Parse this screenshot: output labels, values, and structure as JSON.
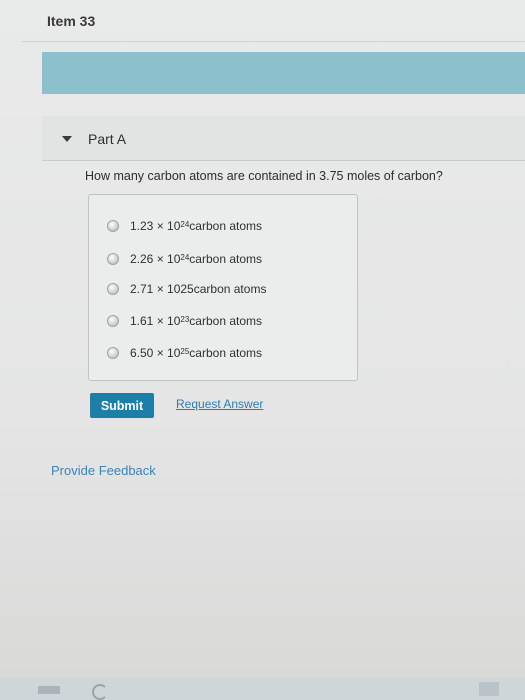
{
  "item": {
    "title": "Item 33"
  },
  "part": {
    "label": "Part A"
  },
  "question": {
    "text": "How many carbon atoms are contained in 3.75 moles of carbon?"
  },
  "options": [
    {
      "mantissa": "1.23 × 10",
      "exponent": "24",
      "unit": " carbon atoms"
    },
    {
      "mantissa": "2.26 × 10",
      "exponent": "24",
      "unit": " carbon atoms"
    },
    {
      "mantissa": "2.71 × 1025",
      "exponent": "",
      "unit": " carbon atoms"
    },
    {
      "mantissa": "1.61 × 10",
      "exponent": "23",
      "unit": " carbon atoms"
    },
    {
      "mantissa": "6.50 × 10",
      "exponent": "25",
      "unit": " carbon atoms"
    }
  ],
  "actions": {
    "submit_label": "Submit",
    "request_answer_label": "Request Answer"
  },
  "footer": {
    "feedback_label": "Provide Feedback"
  },
  "colors": {
    "banner": "#8bc0cc",
    "submit": "#1b7fa8",
    "link": "#2a7fb0"
  }
}
